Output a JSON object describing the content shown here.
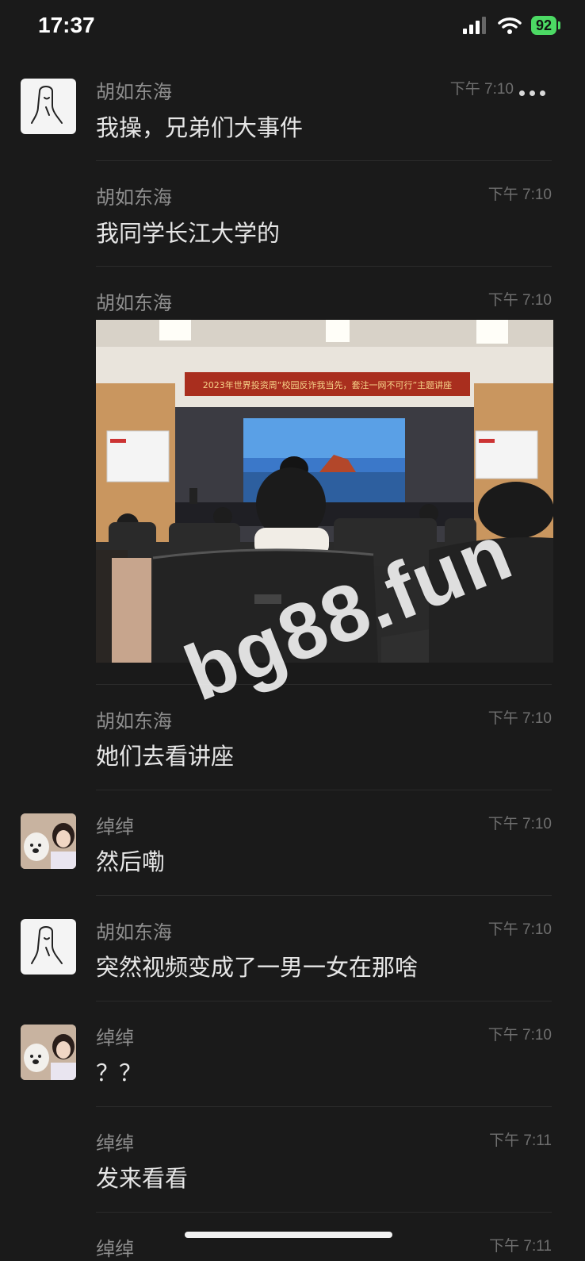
{
  "status_bar": {
    "time": "17:37",
    "battery": "92"
  },
  "messages": [
    {
      "sender": "胡如东海",
      "time": "下午 7:10",
      "text": "我操，兄弟们大事件"
    },
    {
      "sender": "胡如东海",
      "time": "下午 7:10",
      "text": "我同学长江大学的"
    },
    {
      "sender": "胡如东海",
      "time": "下午 7:10",
      "image_banner": "2023年世界投资周“校园反诈我当先，套注一网不可行”主题讲座"
    },
    {
      "sender": "胡如东海",
      "time": "下午 7:10",
      "text": "她们去看讲座"
    },
    {
      "sender": "绰绰",
      "time": "下午 7:10",
      "text": "然后嘞"
    },
    {
      "sender": "胡如东海",
      "time": "下午 7:10",
      "text": "突然视频变成了一男一女在那啥"
    },
    {
      "sender": "绰绰",
      "time": "下午 7:10",
      "text": "？？"
    },
    {
      "sender": "绰绰",
      "time": "下午 7:11",
      "text": "发来看看"
    },
    {
      "sender": "绰绰",
      "time": "下午 7:11"
    }
  ],
  "watermark": "bg88.fun",
  "colors": {
    "background": "#1a1a1a",
    "battery": "#4cd964"
  }
}
